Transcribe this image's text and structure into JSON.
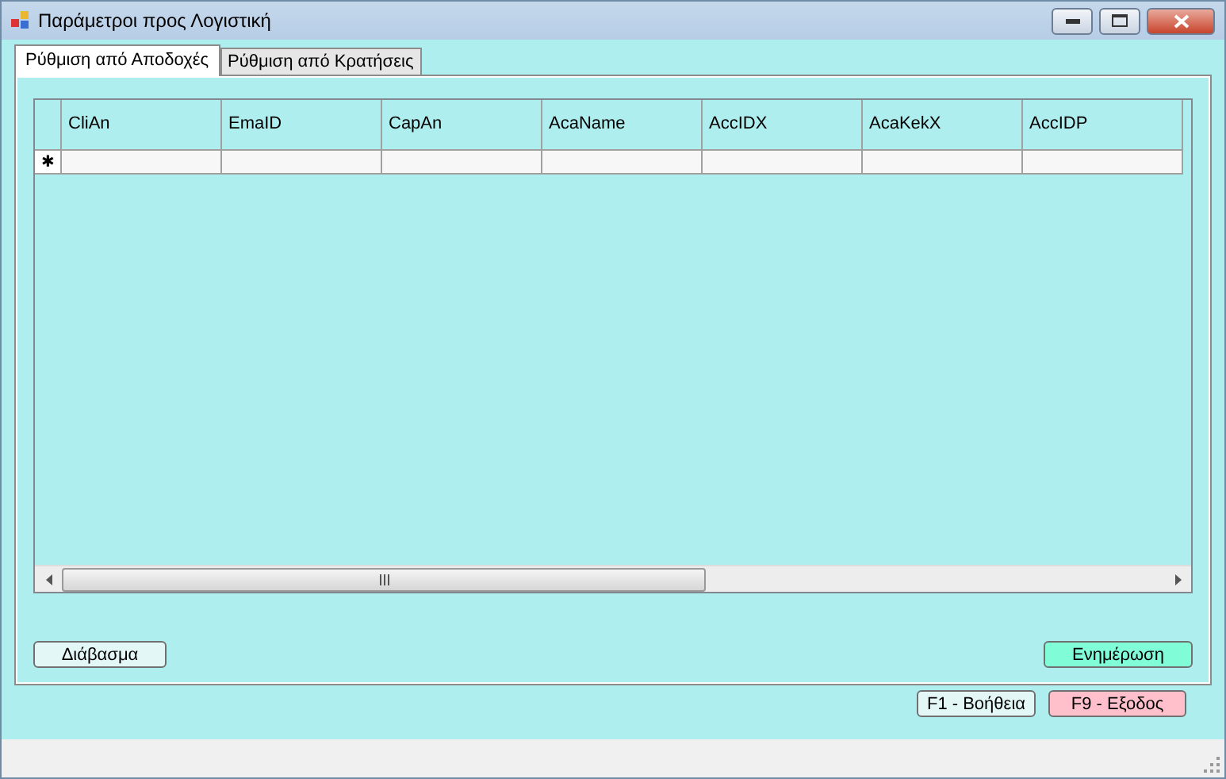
{
  "window": {
    "title": "Παράμετροι προς Λογιστική"
  },
  "tabs": [
    {
      "label": "Ρύθμιση από Αποδοχές",
      "selected": true
    },
    {
      "label": "Ρύθμιση από Κρατήσεις",
      "selected": false
    }
  ],
  "grid": {
    "columns": [
      "CliAn",
      "EmaID",
      "CapAn",
      "AcaName",
      "AccIDX",
      "AcaKekX",
      "AccIDP"
    ],
    "new_row_marker": "✱"
  },
  "panel_buttons": [
    {
      "label": "Διάβασμα",
      "kind": "plain"
    },
    {
      "label": "Ενημέρωση",
      "kind": "update"
    }
  ],
  "footer_buttons": [
    {
      "label": "F1 - Βοήθεια",
      "kind": "plain"
    },
    {
      "label": "F9 - Εξοδος",
      "kind": "exit"
    }
  ]
}
